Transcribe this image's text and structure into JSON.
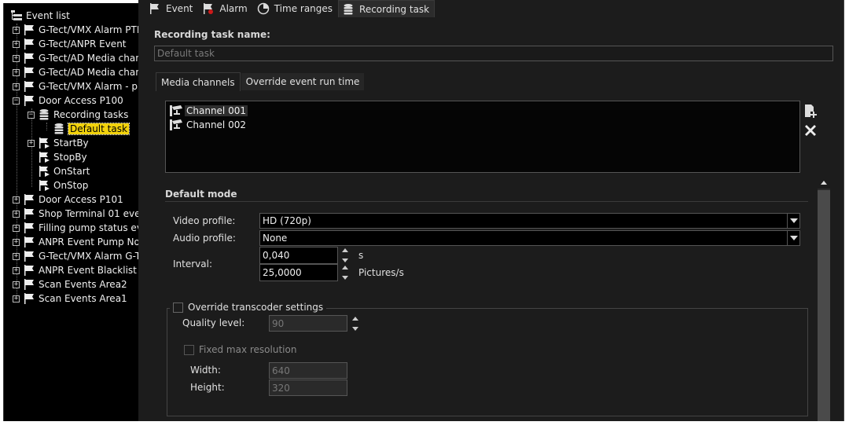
{
  "tree": {
    "root_label": "Event list",
    "items": [
      {
        "label": "G-Tect/VMX Alarm PTH",
        "expander": "+"
      },
      {
        "label": "G-Tect/ANPR Event",
        "expander": "+"
      },
      {
        "label": "G-Tect/AD Media chan",
        "expander": "+"
      },
      {
        "label": "G-Tect/AD Media chan",
        "expander": "+"
      },
      {
        "label": "G-Tect/VMX Alarm - pr",
        "expander": "+"
      },
      {
        "label": "Door Access P100",
        "expander": "−"
      },
      {
        "label": "Recording tasks",
        "expander": "−"
      },
      {
        "label": "Default task",
        "expander": ""
      },
      {
        "label": "StartBy",
        "expander": "+"
      },
      {
        "label": "StopBy",
        "expander": ""
      },
      {
        "label": "OnStart",
        "expander": ""
      },
      {
        "label": "OnStop",
        "expander": ""
      },
      {
        "label": "Door Access P101",
        "expander": "+"
      },
      {
        "label": "Shop Terminal 01 event",
        "expander": "+"
      },
      {
        "label": "Filling pump status eve",
        "expander": "+"
      },
      {
        "label": "ANPR Event Pump No 1",
        "expander": "+"
      },
      {
        "label": "G-Tect/VMX Alarm G-T",
        "expander": "+"
      },
      {
        "label": "ANPR Event Blacklist",
        "expander": "+"
      },
      {
        "label": "Scan Events Area2",
        "expander": "+"
      },
      {
        "label": "Scan Events Area1",
        "expander": "+"
      }
    ]
  },
  "tabs": {
    "event": "Event",
    "alarm": "Alarm",
    "time_ranges": "Time ranges",
    "recording_task": "Recording task"
  },
  "form": {
    "task_name_label": "Recording task name:",
    "task_name_value": "Default task",
    "sub_tabs": {
      "media_channels": "Media channels",
      "override_run_time": "Override event run time"
    },
    "channels": [
      "Channel 001",
      "Channel 002"
    ],
    "default_mode_title": "Default mode",
    "video_profile_label": "Video profile:",
    "video_profile_value": "HD (720p)",
    "audio_profile_label": "Audio profile:",
    "audio_profile_value": "None",
    "interval_label": "Interval:",
    "interval_seconds": "0,040",
    "interval_seconds_unit": "s",
    "interval_pictures": "25,0000",
    "interval_pictures_unit": "Pictures/s",
    "override_transcoder_label": "Override transcoder settings",
    "quality_level_label": "Quality level:",
    "quality_level_value": "90",
    "fixed_max_resolution_label": "Fixed max resolution",
    "width_label": "Width:",
    "width_value": "640",
    "height_label": "Height:",
    "height_value": "320"
  },
  "colors": {
    "selection_yellow": "#f2d20c",
    "panel_bg": "#1c1c1c",
    "delete_red": "#cc1b1b"
  }
}
